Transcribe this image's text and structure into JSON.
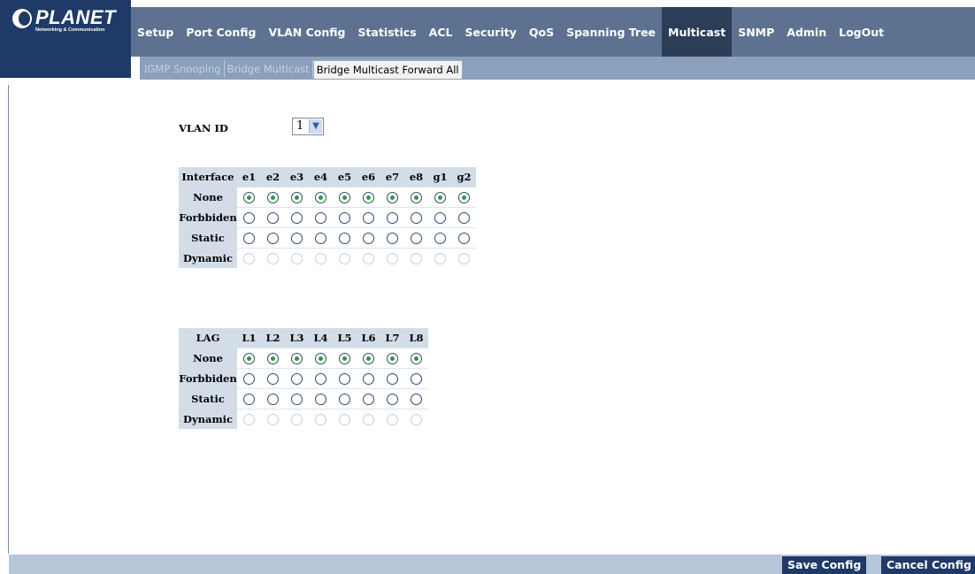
{
  "brand": {
    "name": "PLANET",
    "tagline": "Networking & Communication"
  },
  "menu": [
    {
      "label": "Setup"
    },
    {
      "label": "Port Config"
    },
    {
      "label": "VLAN Config"
    },
    {
      "label": "Statistics"
    },
    {
      "label": "ACL"
    },
    {
      "label": "Security"
    },
    {
      "label": "QoS"
    },
    {
      "label": "Spanning Tree"
    },
    {
      "label": "Multicast"
    },
    {
      "label": "SNMP"
    },
    {
      "label": "Admin"
    },
    {
      "label": "LogOut"
    }
  ],
  "active_menu": "Multicast",
  "submenu": [
    {
      "label": "IGMP Snooping"
    },
    {
      "label": "Bridge Multicast"
    },
    {
      "label": "Bridge Multicast Forward All"
    }
  ],
  "active_submenu": "Bridge Multicast Forward All",
  "vlan": {
    "label": "VLAN ID",
    "selected": "1"
  },
  "interface_table": {
    "header": "Interface",
    "ports": [
      "e1",
      "e2",
      "e3",
      "e4",
      "e5",
      "e6",
      "e7",
      "e8",
      "g1",
      "g2"
    ],
    "rows": [
      "None",
      "Forbbiden",
      "Static",
      "Dynamic"
    ],
    "selected_row": "None",
    "disabled_row": "Dynamic"
  },
  "lag_table": {
    "header": "LAG",
    "ports": [
      "L1",
      "L2",
      "L3",
      "L4",
      "L5",
      "L6",
      "L7",
      "L8"
    ],
    "rows": [
      "None",
      "Forbbiden",
      "Static",
      "Dynamic"
    ],
    "selected_row": "None",
    "disabled_row": "Dynamic"
  },
  "buttons": {
    "save": "Save Config",
    "cancel": "Cancel Config"
  },
  "colors": {
    "header": "#5d7290",
    "logo_bg": "#1f3a66",
    "cell_header": "#d2dde8",
    "radio_selected": "#2e9a3a"
  }
}
